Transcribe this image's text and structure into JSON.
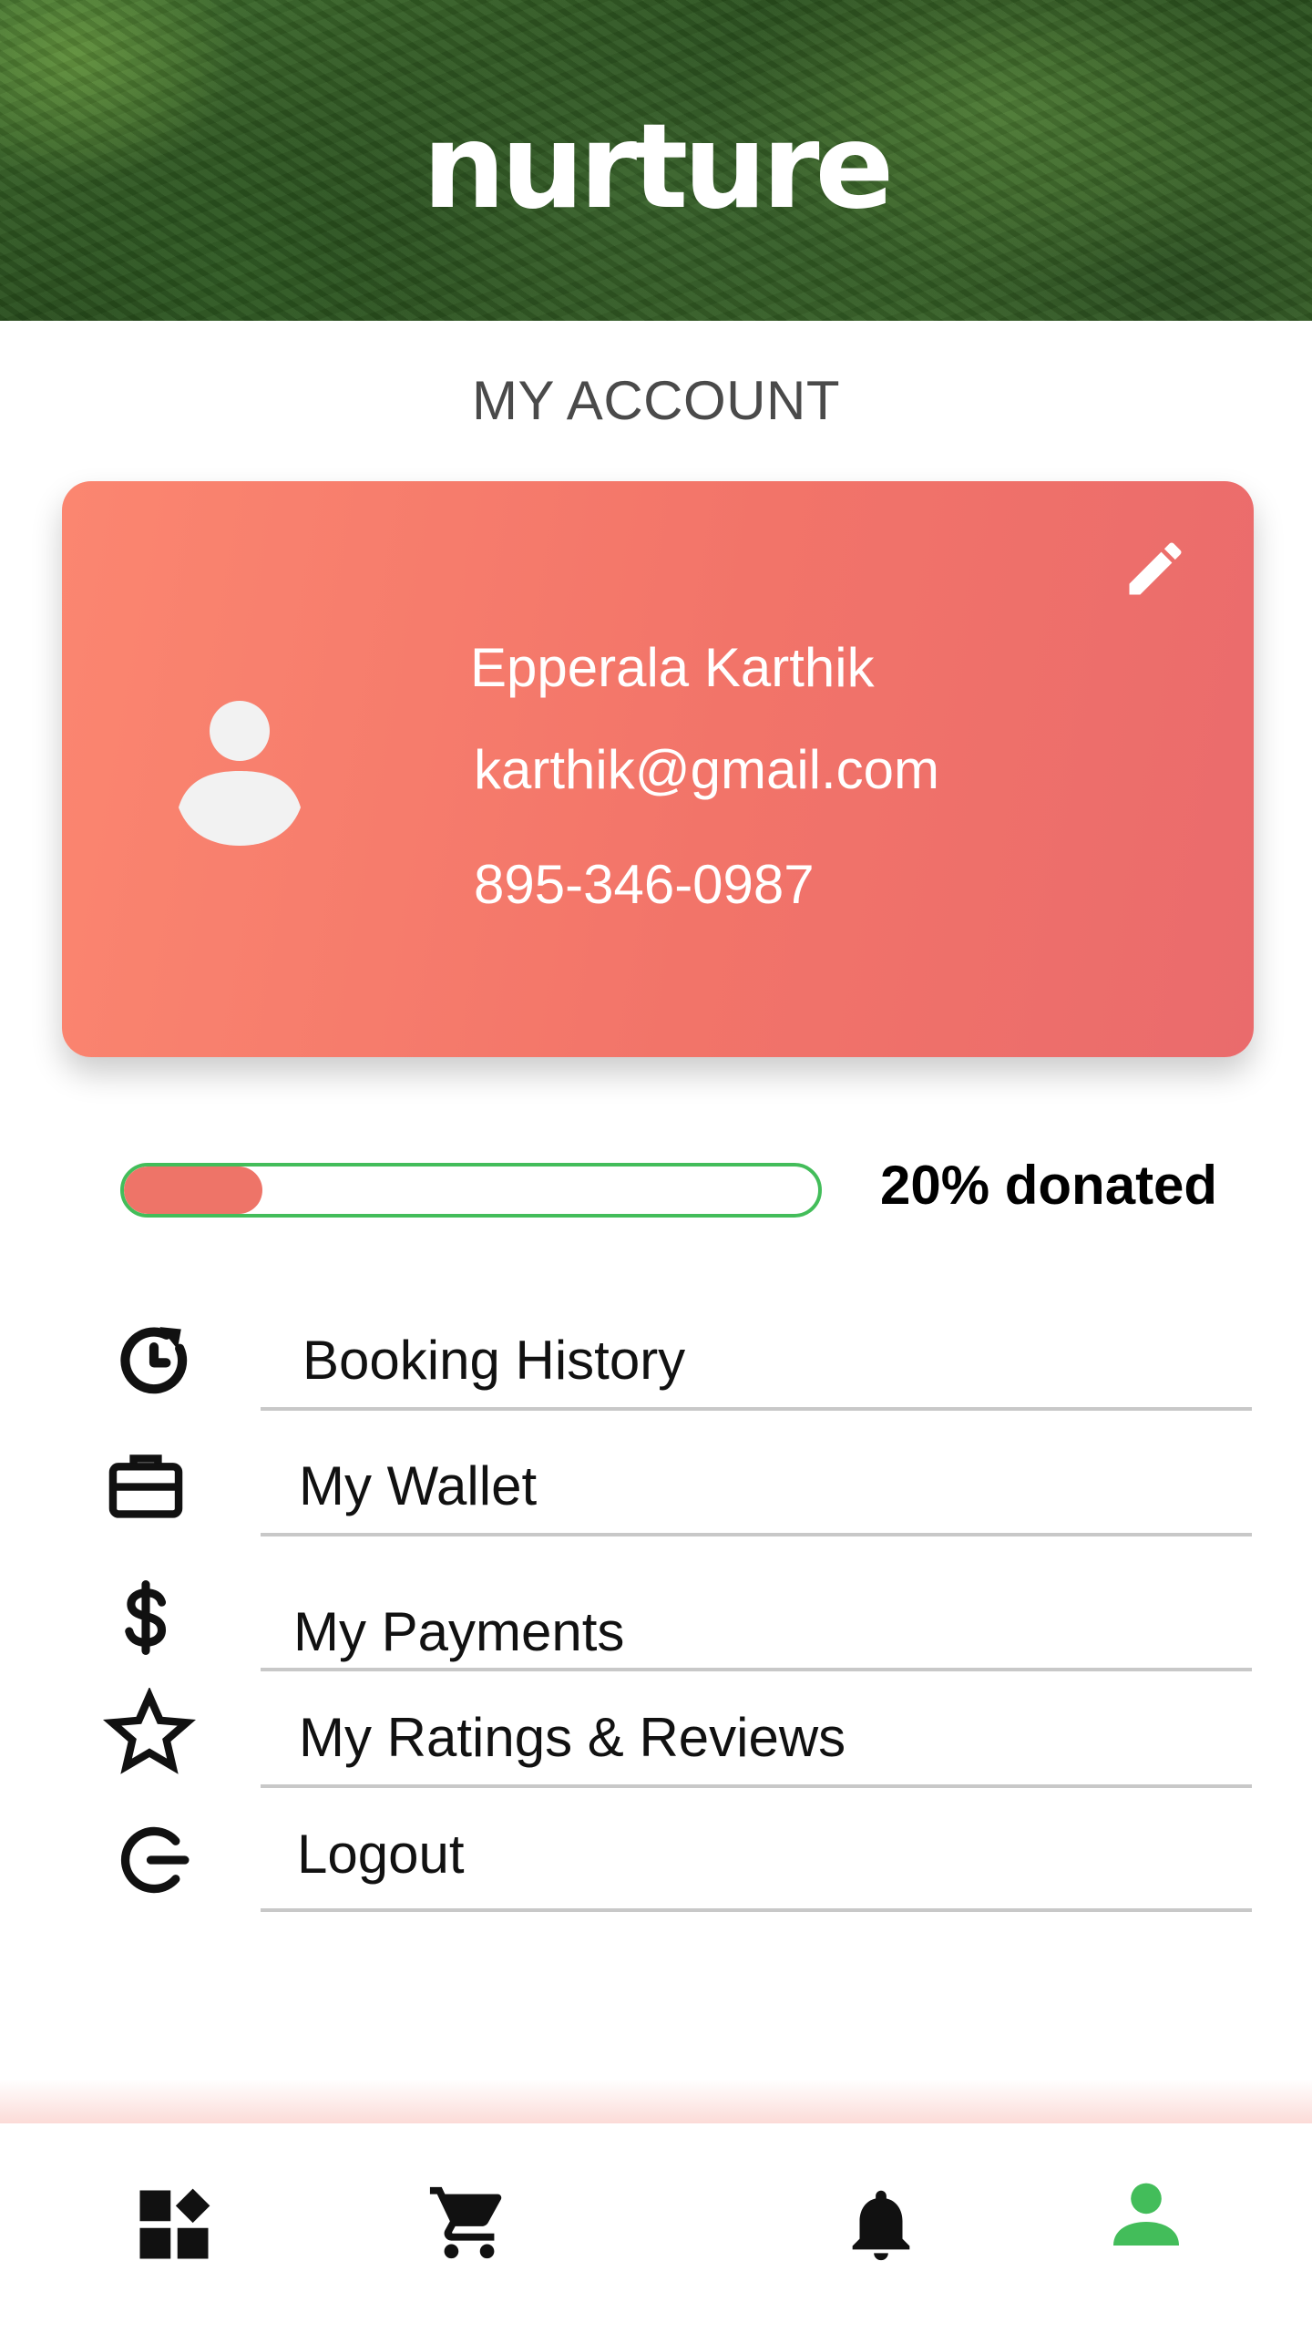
{
  "header": {
    "brand": "nurture"
  },
  "page": {
    "title": "MY ACCOUNT"
  },
  "profile": {
    "name": "Epperala Karthik",
    "email": "karthik@gmail.com",
    "phone": "895-346-0987"
  },
  "donation": {
    "percent": 20,
    "label": "20% donated"
  },
  "menu": {
    "items": [
      {
        "label": "Booking History",
        "icon": "history-icon"
      },
      {
        "label": "My Wallet",
        "icon": "briefcase-icon"
      },
      {
        "label": "My Payments",
        "icon": "dollar-icon"
      },
      {
        "label": "My Ratings & Reviews",
        "icon": "star-icon"
      },
      {
        "label": "Logout",
        "icon": "logout-icon"
      }
    ]
  },
  "bottom_nav": {
    "items": [
      {
        "icon": "dashboard-icon",
        "active": false
      },
      {
        "icon": "cart-icon",
        "active": false
      },
      {
        "icon": "bell-icon",
        "active": false
      },
      {
        "icon": "person-icon",
        "active": true
      }
    ]
  },
  "colors": {
    "accent_green": "#43bd5a",
    "card_start": "#fb8670",
    "card_end": "#ea6b6c",
    "progress_fill": "#ee7468"
  }
}
